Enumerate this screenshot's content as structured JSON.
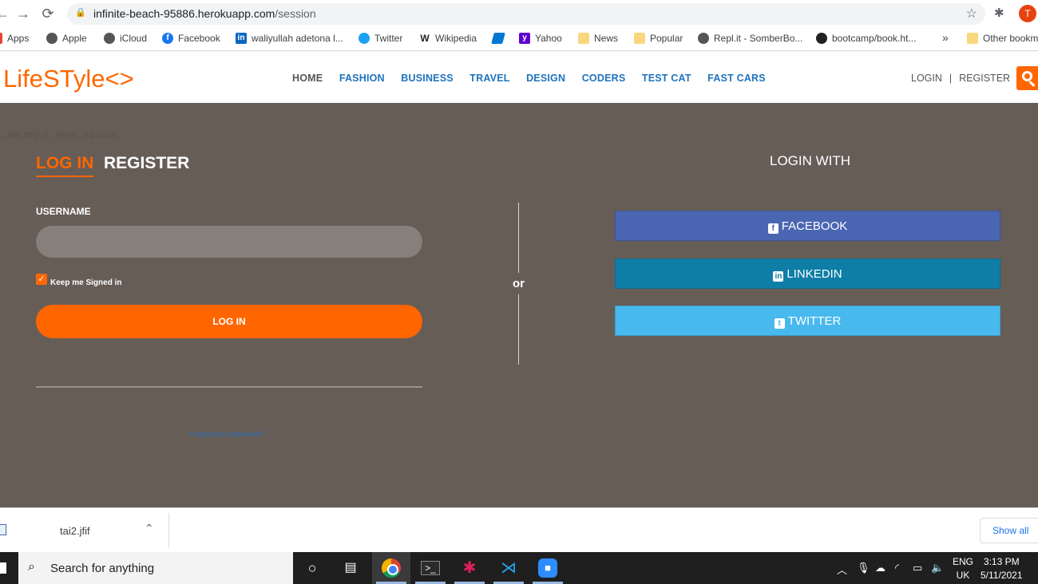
{
  "browser": {
    "url_host": "infinite-beach-95886.herokuapp.com",
    "url_path": "/session",
    "profile_initial": "T",
    "bookmarks": [
      {
        "label": "Apps",
        "icon": "apps-grid-icon"
      },
      {
        "label": "Apple",
        "icon": "apple-icon"
      },
      {
        "label": "iCloud",
        "icon": "apple-icon"
      },
      {
        "label": "Facebook",
        "icon": "facebook-icon"
      },
      {
        "label": "waliyullah adetona l...",
        "icon": "linkedin-icon"
      },
      {
        "label": "Twitter",
        "icon": "twitter-icon"
      },
      {
        "label": "Wikipedia",
        "icon": "wikipedia-icon"
      },
      {
        "label": "",
        "icon": "azure-icon"
      },
      {
        "label": "Yahoo",
        "icon": "yahoo-icon"
      },
      {
        "label": "News",
        "icon": "folder-icon"
      },
      {
        "label": "Popular",
        "icon": "folder-icon"
      },
      {
        "label": "Repl.it - SomberBo...",
        "icon": "replit-icon"
      },
      {
        "label": "bootcamp/book.ht...",
        "icon": "github-icon"
      }
    ],
    "more_bookmarks": "»",
    "other_bookmarks": "Other bookm"
  },
  "site": {
    "logo": "LifeSTyle<>",
    "nav": [
      "HOME",
      "FASHION",
      "BUSINESS",
      "TRAVEL",
      "DESIGN",
      "CODERS",
      "TEST CAT",
      "FAST CARS"
    ],
    "login_link": "LOGIN",
    "separator": "|",
    "register_link": "REGISTER",
    "accent_color": "#ff6600"
  },
  "form": {
    "ghost_text": "...ate http://...sess...ed cont...",
    "tab_login": "LOG IN",
    "tab_register": "REGISTER",
    "username_label": "USERNAME",
    "username_value": "",
    "keep_signed_in": "Keep me Signed in",
    "keep_signed_in_checked": true,
    "login_button": "LOG IN",
    "forgot_link": "Forgot your password?"
  },
  "divider": {
    "or": "or"
  },
  "social": {
    "heading": "LOGIN WITH",
    "facebook": "FACEBOOK",
    "linkedin": "LINKEDIN",
    "twitter": "TWITTER",
    "facebook_color": "#4a65b2",
    "linkedin_color": "#0e7ea7",
    "twitter_color": "#48b9ee"
  },
  "downloads": {
    "file_name": "tai2.jfif",
    "show_all": "Show all"
  },
  "taskbar": {
    "search_placeholder": "Search for anything",
    "lang_top": "ENG",
    "lang_bottom": "UK",
    "time": "3:13 PM",
    "date": "5/11/2021"
  }
}
